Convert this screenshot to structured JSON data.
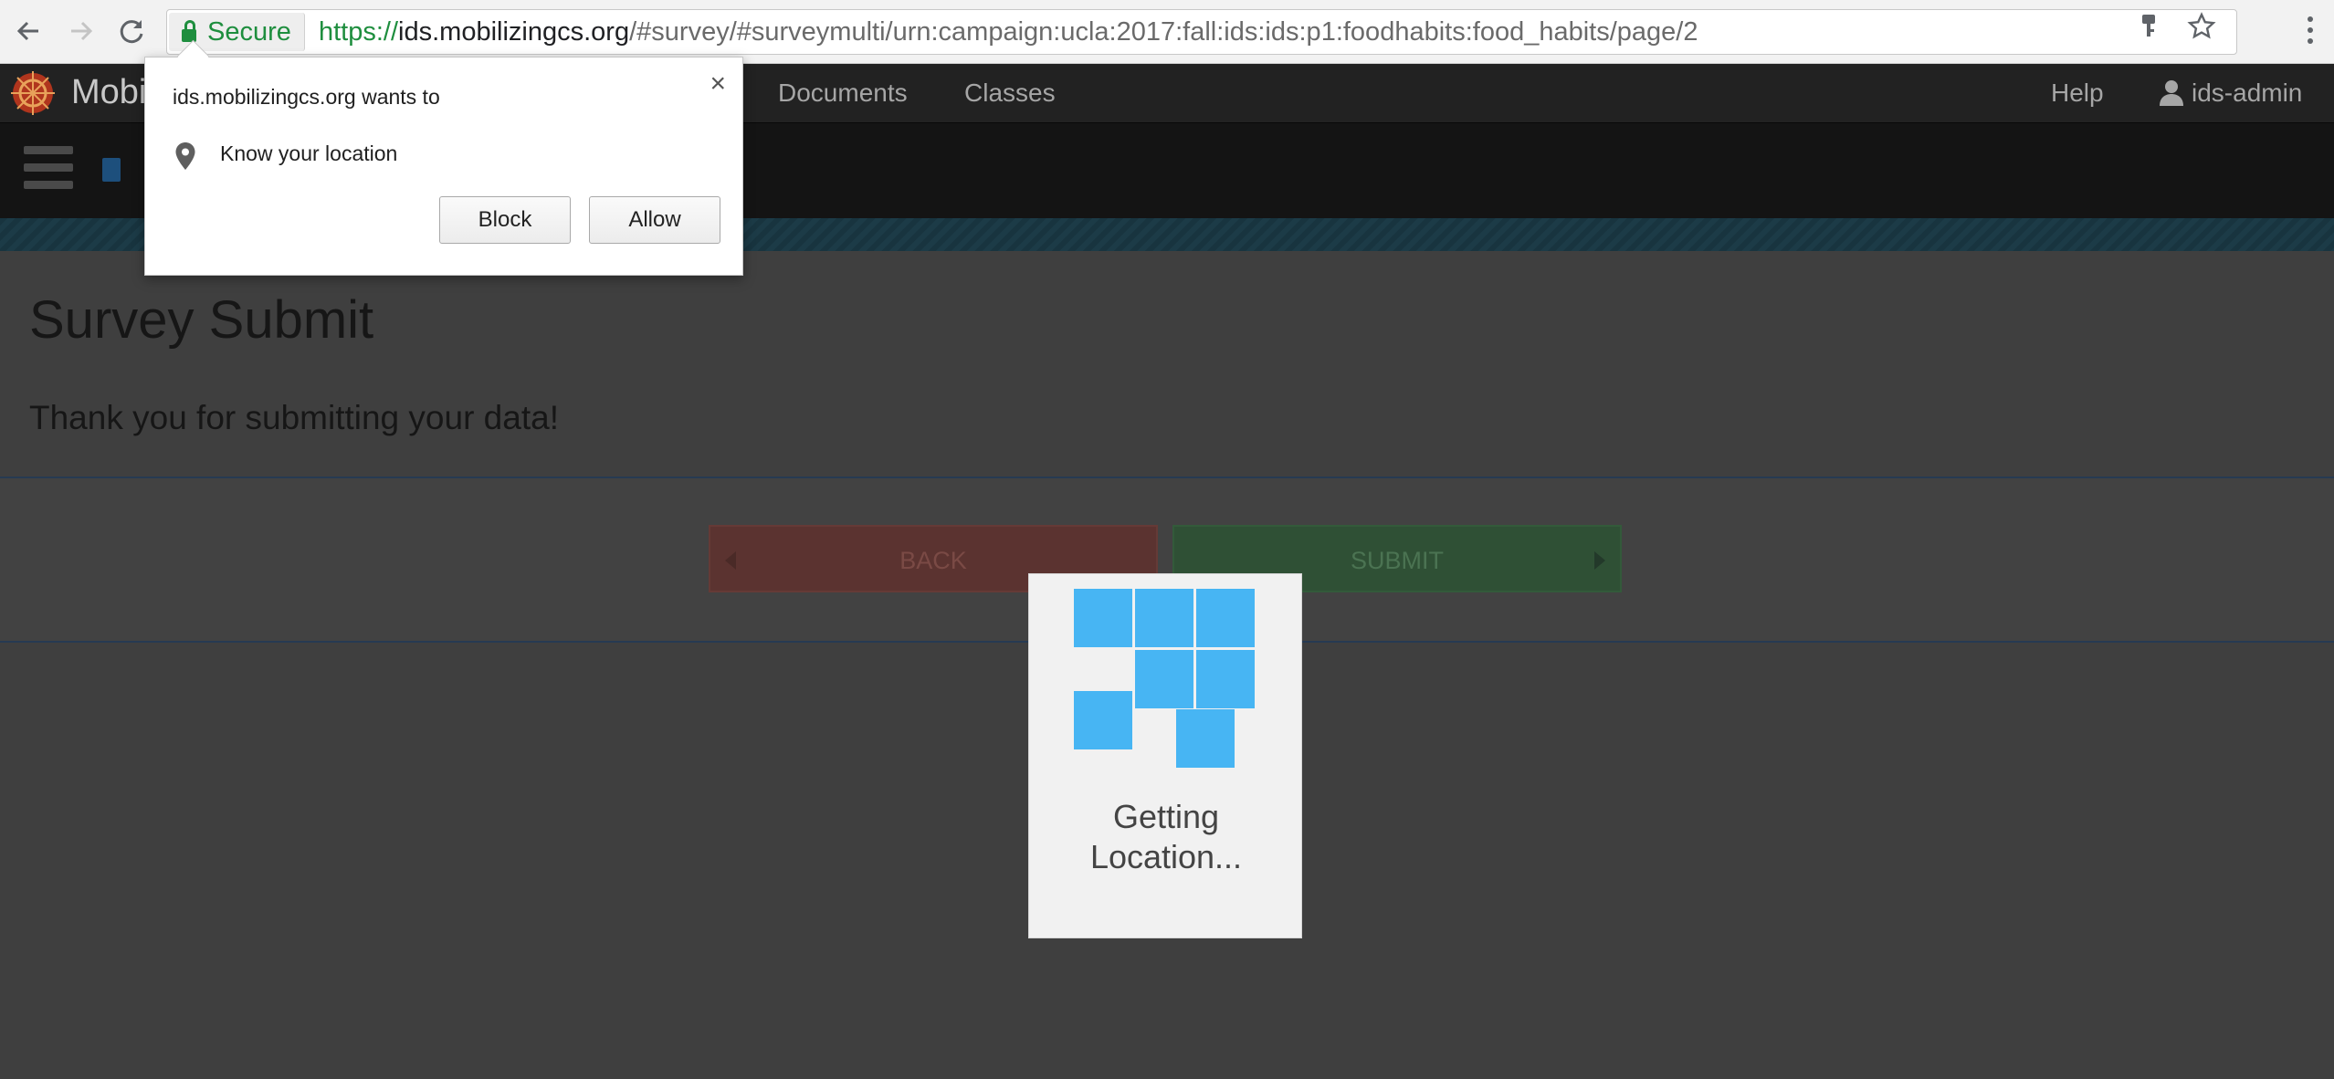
{
  "browser": {
    "security_label": "Secure",
    "url_scheme": "https://",
    "url_host": "ids.mobilizingcs.org",
    "url_path": "/#survey/#surveymulti/urn:campaign:ucla:2017:fall:ids:ids:p1:foodhabits:food_habits/page/2",
    "icons": [
      "back-arrow-icon",
      "forward-arrow-icon",
      "reload-icon",
      "lock-icon",
      "key-icon",
      "star-icon",
      "more-menu-icon"
    ]
  },
  "app_nav": {
    "brand": "Mobi",
    "links": [
      "Documents",
      "Classes"
    ],
    "help": "Help",
    "user": "ids-admin"
  },
  "survey": {
    "title": "Survey Submit",
    "message": "Thank you for submitting your data!",
    "back_label": "BACK",
    "submit_label": "SUBMIT"
  },
  "loader": {
    "text_line1": "Getting",
    "text_line2": "Location...",
    "color": "#47b5f3"
  },
  "permission": {
    "title": "ids.mobilizingcs.org wants to",
    "request": "Know your location",
    "block_label": "Block",
    "allow_label": "Allow",
    "close_glyph": "×"
  },
  "colors": {
    "secure_green": "#1e8e3e",
    "nav_bg": "#222222",
    "back_button": "#5b3330",
    "submit_button": "#2f5035"
  }
}
